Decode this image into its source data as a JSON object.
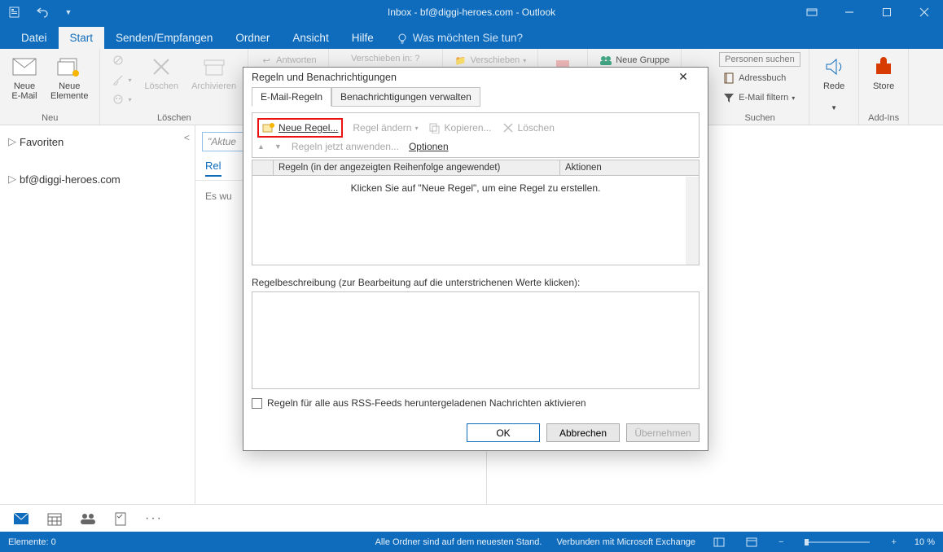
{
  "window": {
    "title": "Inbox - bf@diggi-heroes.com - Outlook"
  },
  "ribbon_tabs": {
    "datei": "Datei",
    "start": "Start",
    "senden": "Senden/Empfangen",
    "ordner": "Ordner",
    "ansicht": "Ansicht",
    "hilfe": "Hilfe",
    "tell_me": "Was möchten Sie tun?"
  },
  "ribbon": {
    "neu": {
      "email": "Neue\nE-Mail",
      "elemente": "Neue\nElemente",
      "label": "Neu"
    },
    "loeschen": {
      "ignore": "",
      "del": "Löschen",
      "arch": "Archivieren",
      "label": "Löschen"
    },
    "antworten": {
      "reply": "Antworten",
      "label": ""
    },
    "verschieben": {
      "in": "Verschieben in: ?",
      "move": "Verschieben",
      "label": ""
    },
    "gruppen": {
      "neue": "Neue Gruppe",
      "label": ""
    },
    "suchen": {
      "personen": "Personen suchen",
      "adr": "Adressbuch",
      "filter": "E-Mail filtern",
      "label": "Suchen"
    },
    "rede": {
      "btn": "Rede",
      "label": ""
    },
    "store": {
      "btn": "Store",
      "label": "Add-Ins"
    }
  },
  "folders": {
    "fav": "Favoriten",
    "acct": "bf@diggi-heroes.com"
  },
  "msglist": {
    "search_ph": "\"Aktue",
    "tab_relevant": "Rel",
    "hint": "Es wu"
  },
  "bottombar": {
    "more": "···"
  },
  "statusbar": {
    "elements": "Elemente: 0",
    "folders": "Alle Ordner sind auf dem neuesten Stand.",
    "connected": "Verbunden mit Microsoft Exchange",
    "zoom": "10 %"
  },
  "dialog": {
    "title": "Regeln und Benachrichtigungen",
    "tab_rules": "E-Mail-Regeln",
    "tab_notif": "Benachrichtigungen verwalten",
    "btn_new": "Neue Regel...",
    "btn_change": "Regel ändern",
    "btn_copy": "Kopieren...",
    "btn_delete": "Löschen",
    "apply_now": "Regeln jetzt anwenden...",
    "options": "Optionen",
    "col_rules": "Regeln (in der angezeigten Reihenfolge angewendet)",
    "col_actions": "Aktionen",
    "empty_hint": "Klicken Sie auf \"Neue Regel\", um eine Regel zu erstellen.",
    "desc_label": "Regelbeschreibung (zur Bearbeitung auf die unterstrichenen Werte klicken):",
    "rss_label": "Regeln für alle aus RSS-Feeds heruntergeladenen Nachrichten aktivieren",
    "ok": "OK",
    "cancel": "Abbrechen",
    "apply": "Übernehmen"
  },
  "partial_ribbon": {
    "chen": "chen"
  }
}
